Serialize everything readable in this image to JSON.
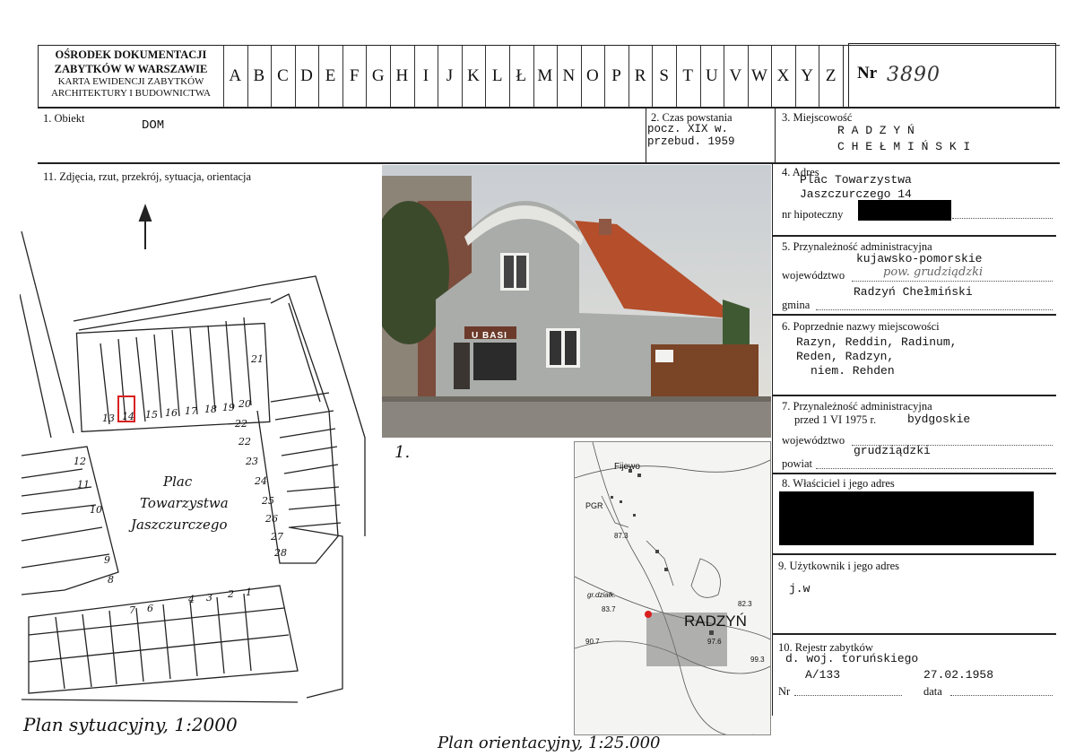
{
  "header": {
    "institution_line1": "OŚRODEK DOKUMENTACJI",
    "institution_line2": "ZABYTKÓW W WARSZAWIE",
    "institution_line3": "KARTA EWIDENCJI ZABYTKÓW",
    "institution_line4": "ARCHITEKTURY I BUDOWNICTWA",
    "alphabet": [
      "A",
      "B",
      "C",
      "D",
      "E",
      "F",
      "G",
      "H",
      "I",
      "J",
      "K",
      "L",
      "Ł",
      "M",
      "N",
      "O",
      "P",
      "R",
      "S",
      "T",
      "U",
      "V",
      "W",
      "X",
      "Y",
      "Z"
    ],
    "nr_label": "Nr",
    "nr_value": "3890"
  },
  "fields": {
    "obiekt_label": "1. Obiekt",
    "obiekt_value": "DOM",
    "czas_label": "2. Czas powstania",
    "czas_value1": "pocz. XIX w.",
    "czas_value2": "przebud. 1959",
    "miejscowosc_label": "3. Miejscowość",
    "miejscowosc_value1": "R A D Z Y Ń",
    "miejscowosc_value2": "C H E Ł M I Ń S K I",
    "zdjecia_label": "11. Zdjęcia, rzut, przekrój, sytuacja, orientacja",
    "adres_label": "4. Adres",
    "adres_value1": "Plac Towarzystwa",
    "adres_value2": "Jaszczurczego 14",
    "hipoteczny_label": "nr hipoteczny",
    "admin_label": "5. Przynależność administracyjna",
    "woj_label": "województwo",
    "woj_value": "kujawsko-pomorskie",
    "powiat_handwritten": "pow. grudziądzki",
    "gmina_label": "gmina",
    "gmina_value": "Radzyń Chełmiński",
    "poprzednie_label": "6. Poprzednie nazwy miejscowości",
    "poprzednie_value1": "Razyn, Reddin, Radinum,",
    "poprzednie_value2": "Reden, Radzyn,",
    "poprzednie_value3": "niem. Rehden",
    "admin1975_label": "7. Przynależność administracyjna",
    "admin1975_sub": "przed 1 VI 1975 r.",
    "admin1975_value": "bydgoskie",
    "woj2_label": "województwo",
    "powiat2_value": "grudziądzki",
    "powiat2_label": "powiat",
    "wlasciciel_label": "8. Właściciel i jego adres",
    "uzytkownik_label": "9. Użytkownik i jego adres",
    "uzytkownik_value": "j.w",
    "rejestr_label": "10. Rejestr zabytków",
    "rejestr_value1": "d. woj. toruńskiego",
    "rejestr_nr": "A/133",
    "rejestr_date": "27.02.1958",
    "rejestr_nr_label": "Nr",
    "rejestr_data_label": "data"
  },
  "site_plan": {
    "plac_line1": "Plac",
    "plac_line2": "Towarzystwa",
    "plac_line3": "Jaszczurczego",
    "numbers": [
      "13",
      "14",
      "15",
      "16",
      "17",
      "18",
      "19",
      "20",
      "21",
      "22",
      "22",
      "23",
      "24",
      "25",
      "26",
      "27",
      "28",
      "12",
      "11",
      "10",
      "9",
      "8",
      "7",
      "6",
      "4",
      "3",
      "2",
      "1"
    ],
    "caption": "Plan sytuacyjny, 1:2000"
  },
  "photo": {
    "shop_sign": "U BASI",
    "caption_number": "1."
  },
  "orientation_map": {
    "town_label": "RADZYŃ",
    "village_label": "Fijewo",
    "label_pgr": "PGR",
    "label_grdzialk": "gr.działk.",
    "elev1": "87.3",
    "elev2": "83.7",
    "elev3": "90.7",
    "elev4": "97.6",
    "elev5": "82.3",
    "elev6": "99.3",
    "caption": "Plan orientacyjny, 1:25.000"
  },
  "colors": {
    "redaction": "#000000",
    "marker": "#d92020"
  }
}
